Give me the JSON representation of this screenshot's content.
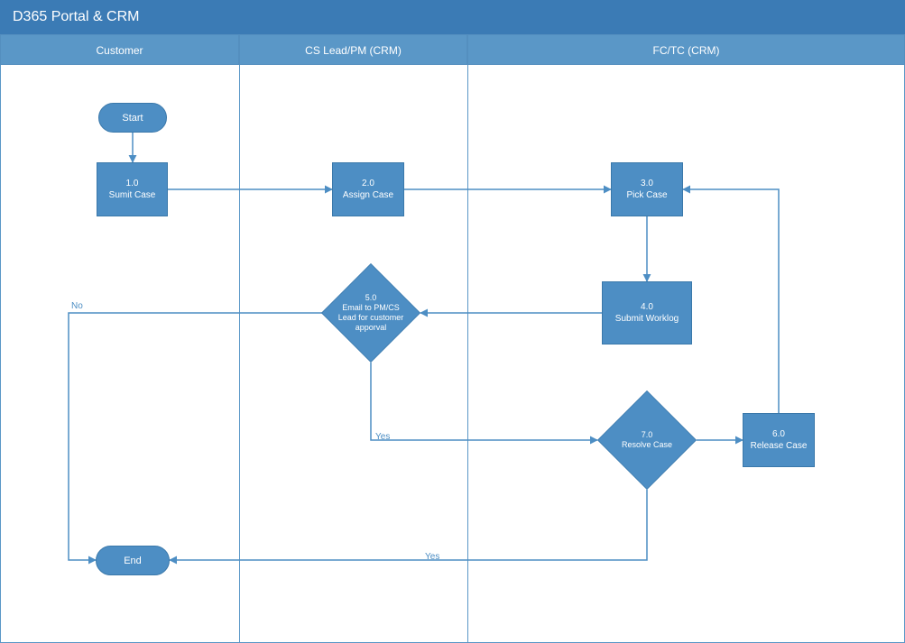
{
  "title": "D365 Portal & CRM",
  "lanes": {
    "l1": "Customer",
    "l2": "CS Lead/PM (CRM)",
    "l3": "FC/TC (CRM)"
  },
  "nodes": {
    "start": "Start",
    "end": "End",
    "n1_num": "1.0",
    "n1_txt": "Sumit Case",
    "n2_num": "2.0",
    "n2_txt": "Assign Case",
    "n3_num": "3.0",
    "n3_txt": "Pick Case",
    "n4_num": "4.0",
    "n4_txt": "Submit Worklog",
    "n5_num": "5.0",
    "n5_txt": "Email to PM/CS Lead for customer apporval",
    "n6_num": "6.0",
    "n6_txt": "Release Case",
    "n7_num": "7.0",
    "n7_txt": "Resolve Case"
  },
  "edge_labels": {
    "no": "No",
    "yes1": "Yes",
    "yes2": "Yes"
  },
  "colors": {
    "header": "#3b7bb5",
    "lane": "#5a97c7",
    "node": "#4d8ec4"
  }
}
